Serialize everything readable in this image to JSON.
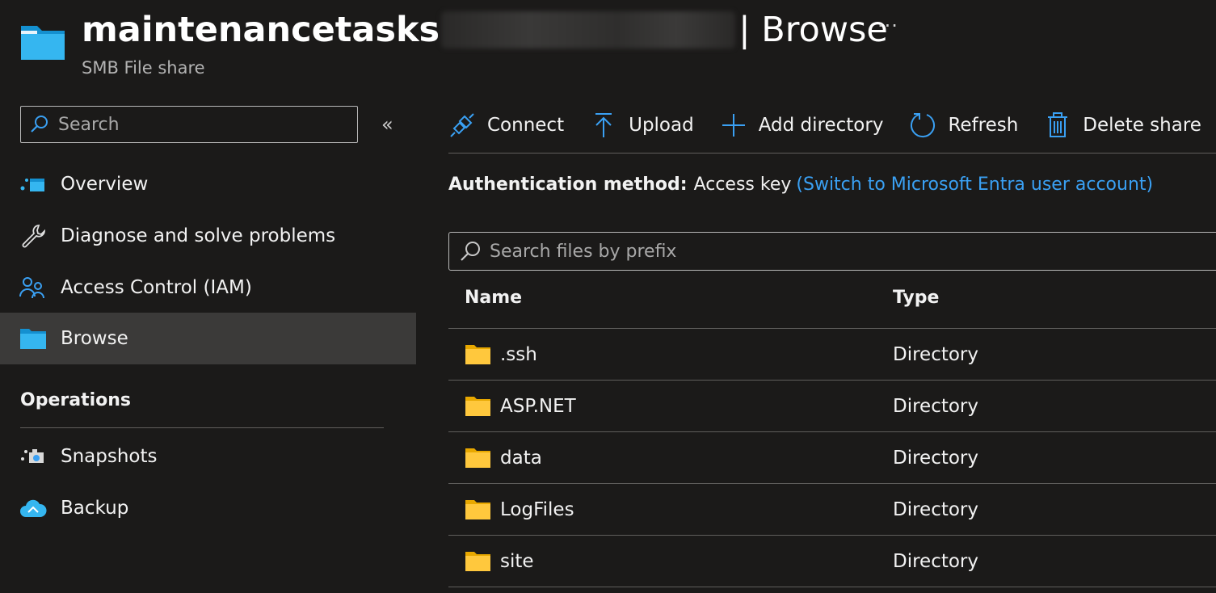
{
  "header": {
    "title_main": "maintenancetasks",
    "title_separator": "| Browse",
    "subtitle": "SMB File share",
    "more_label": "···"
  },
  "sidebar": {
    "search_placeholder": "Search",
    "collapse_label": "«",
    "items": [
      {
        "label": "Overview",
        "icon": "overview-icon"
      },
      {
        "label": "Diagnose and solve problems",
        "icon": "wrench-icon"
      },
      {
        "label": "Access Control (IAM)",
        "icon": "people-icon"
      },
      {
        "label": "Browse",
        "icon": "folder-icon",
        "selected": true
      }
    ],
    "sections": [
      {
        "title": "Operations",
        "items": [
          {
            "label": "Snapshots",
            "icon": "snapshot-icon"
          },
          {
            "label": "Backup",
            "icon": "backup-cloud-icon"
          }
        ]
      }
    ]
  },
  "toolbar": {
    "connect_label": "Connect",
    "upload_label": "Upload",
    "add_directory_label": "Add directory",
    "refresh_label": "Refresh",
    "delete_share_label": "Delete share"
  },
  "auth": {
    "label": "Authentication method:",
    "value": "Access key",
    "switch_link": "(Switch to Microsoft Entra user account)"
  },
  "file_search": {
    "placeholder": "Search files by prefix"
  },
  "table": {
    "columns": [
      "Name",
      "Type"
    ],
    "rows": [
      {
        "name": ".ssh",
        "type": "Directory"
      },
      {
        "name": "ASP.NET",
        "type": "Directory"
      },
      {
        "name": "data",
        "type": "Directory"
      },
      {
        "name": "LogFiles",
        "type": "Directory"
      },
      {
        "name": "site",
        "type": "Directory"
      }
    ]
  },
  "colors": {
    "background": "#1b1a19",
    "selected_nav": "#3b3a39",
    "accent_blue": "#3aa0f3",
    "folder_yellow": "#ffc83d",
    "divider": "#605e5c"
  }
}
